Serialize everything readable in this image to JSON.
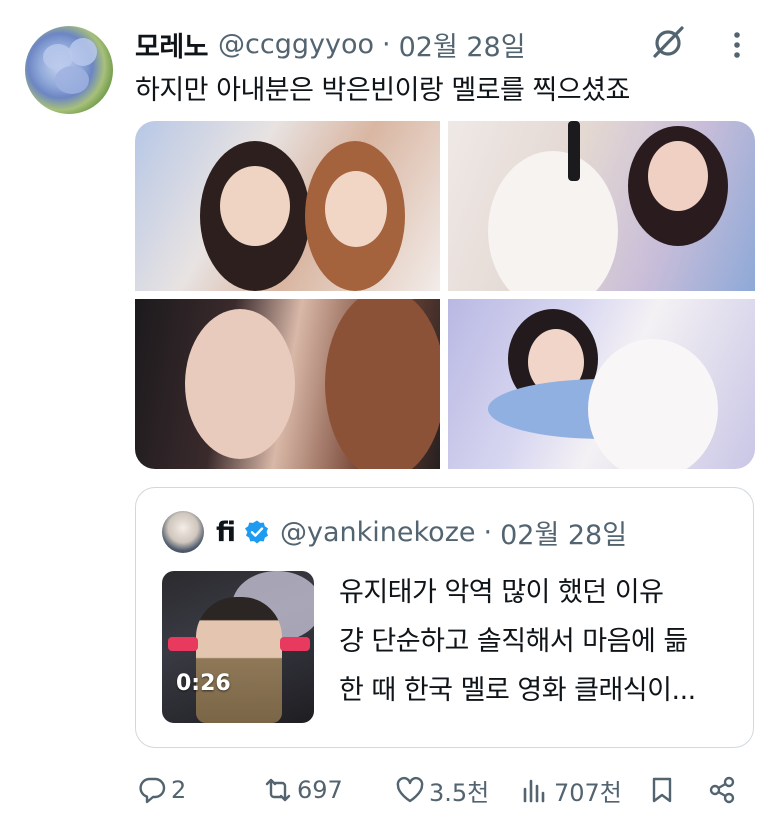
{
  "post": {
    "author_name": "모레노",
    "author_handle": "@ccggyyoo",
    "separator": "·",
    "date": "02월 28일",
    "text": "하지만 아내분은 박은빈이랑 멜로를 찍으셨죠"
  },
  "quoted_post": {
    "author_name": "fi",
    "author_handle": "@yankinekoze",
    "separator": "·",
    "date": "02월 28일",
    "video_duration": "0:26",
    "text_lines": [
      "유지태가 악역 많이 했던 이유",
      "걍 단순하고 솔직해서 마음에 듦",
      "한 때 한국 멜로 영화 클래식이..."
    ]
  },
  "actions": {
    "reply_count": "2",
    "repost_count": "697",
    "like_count": "3.5천",
    "view_count": "707천"
  },
  "colors": {
    "text_primary": "#0f1419",
    "text_secondary": "#536471",
    "verified_blue": "#1d9bf0",
    "border": "#cfd9de"
  },
  "icons": {
    "grok": "grok-icon",
    "more": "more-icon",
    "verified": "verified-badge-icon",
    "reply": "reply-icon",
    "repost": "repost-icon",
    "like": "like-icon",
    "views": "views-icon",
    "bookmark": "bookmark-icon",
    "share": "share-icon"
  }
}
